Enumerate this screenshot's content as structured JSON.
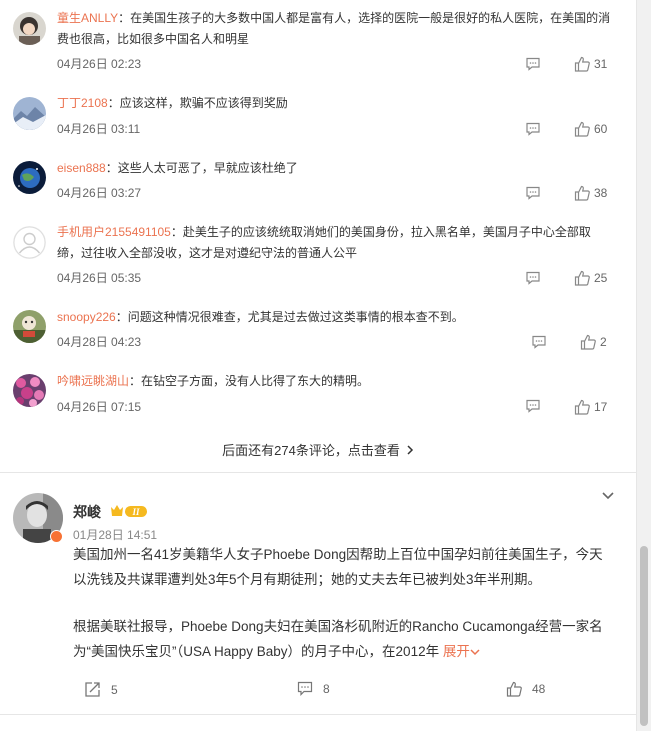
{
  "comments": [
    {
      "user": "童生ANLLY",
      "sep": "：",
      "text": "在美国生孩子的大多数中国人都是富有人，选择的医院一般是很好的私人医院，在美国的消费也很高，比如很多中国名人和明星",
      "time": "04月26日 02:23",
      "likes": "31"
    },
    {
      "user": "丁丁2108",
      "sep": "：",
      "text": "应该这样，欺骗不应该得到奖励",
      "time": "04月26日 03:11",
      "likes": "60"
    },
    {
      "user": "eisen888",
      "sep": "：",
      "text": "这些人太可恶了，早就应该杜绝了",
      "time": "04月26日 03:27",
      "likes": "38"
    },
    {
      "user": "手机用户2155491105",
      "sep": "：",
      "text": "赴美生子的应该统统取消她们的美国身份，拉入黑名单，美国月子中心全部取缔，过往收入全部没收，这才是对遵纪守法的普通人公平",
      "time": "04月26日 05:35",
      "likes": "25"
    },
    {
      "user": "snoopy226",
      "sep": "：",
      "text": "问题这种情况很难查，尤其是过去做过这类事情的根本查不到。",
      "time": "04月28日 04:23",
      "likes": "2"
    },
    {
      "user": "吟啸远眺湖山",
      "sep": "：",
      "text": "在钻空子方面，没有人比得了东大的精明。",
      "time": "04月26日 07:15",
      "likes": "17"
    }
  ],
  "more_comments": "后面还有274条评论，点击查看",
  "post": {
    "author": "郑峻",
    "level": "II",
    "time": "01月28日 14:51",
    "paragraph1": "美国加州一名41岁美籍华人女子Phoebe Dong因帮助上百位中国孕妇前往美国生子，今天以洗钱及共谋罪遭判处3年5个月有期徒刑；她的丈夫去年已被判处3年半刑期。",
    "paragraph2": "根据美联社报导，Phoebe Dong夫妇在美国洛杉矶附近的Rancho Cucamonga经营一家名为“美国快乐宝贝”（USA Happy Baby）的月子中心，在2012年",
    "expand": "展开",
    "reposts": "5",
    "comments": "8",
    "likes": "48"
  },
  "colors": {
    "accent": "#eb7350",
    "text": "#333333",
    "meta": "#666666"
  }
}
